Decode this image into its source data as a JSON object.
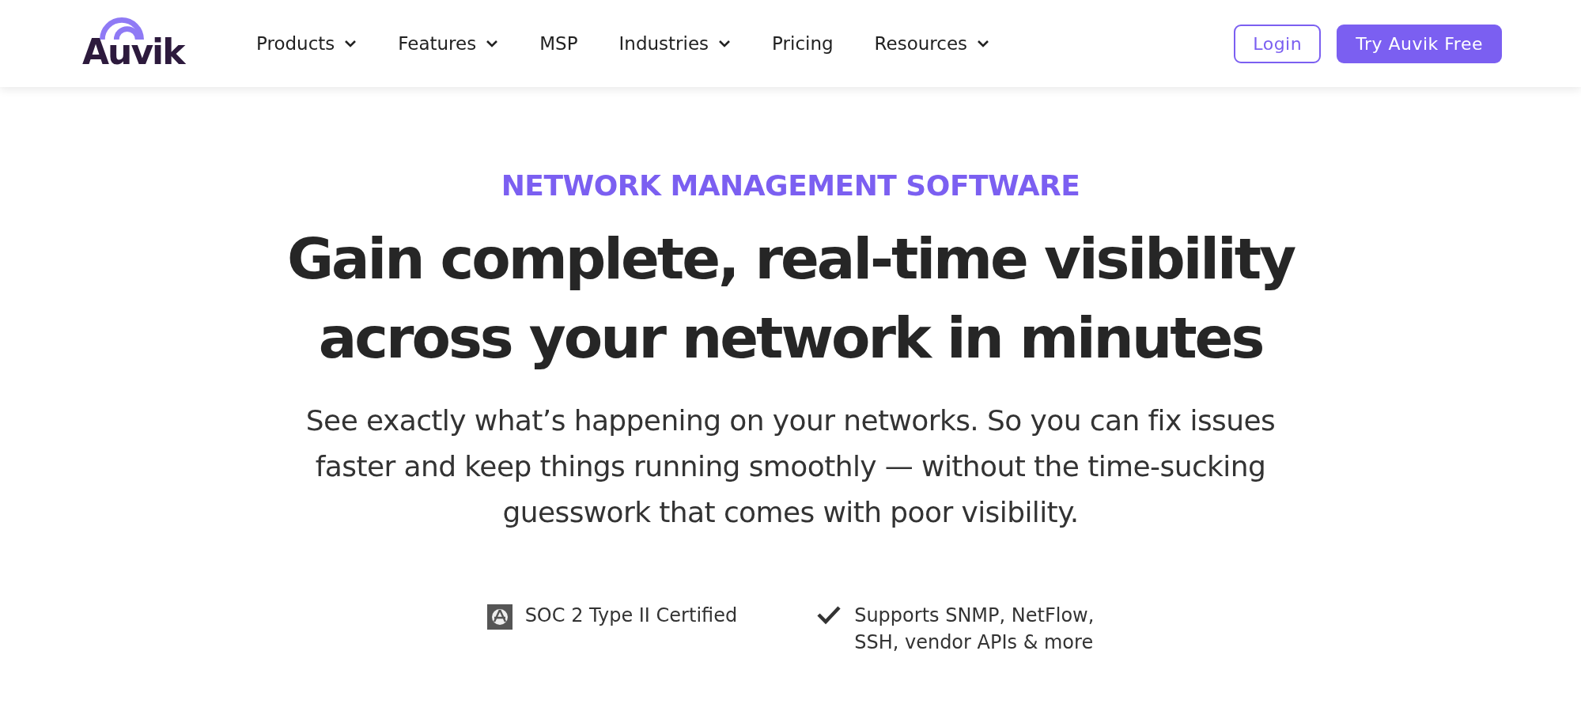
{
  "header": {
    "logo": "Auvik",
    "nav": [
      {
        "label": "Products",
        "dropdown": true
      },
      {
        "label": "Features",
        "dropdown": true
      },
      {
        "label": "MSP",
        "dropdown": false
      },
      {
        "label": "Industries",
        "dropdown": true
      },
      {
        "label": "Pricing",
        "dropdown": false
      },
      {
        "label": "Resources",
        "dropdown": true
      }
    ],
    "buttons": [
      {
        "label": "Login",
        "kind": "outline"
      },
      {
        "label": "Try Auvik Free",
        "kind": "filled"
      }
    ]
  },
  "hero": {
    "eyebrow": "NETWORK MANAGEMENT SOFTWARE",
    "headline": [
      "Gain complete, real-time visibility",
      "across your network in minutes"
    ],
    "description": "See exactly what’s happening on your networks. So you can fix issues faster and keep things running smoothly — without the time-sucking guesswork that comes with poor visibility.",
    "features": [
      {
        "kind": "badge",
        "lines": [
          "SOC 2 Type II Certified"
        ]
      },
      {
        "kind": "check",
        "lines": [
          "Supports SNMP, NetFlow,",
          "SSH, vendor APIs & more"
        ]
      }
    ]
  }
}
